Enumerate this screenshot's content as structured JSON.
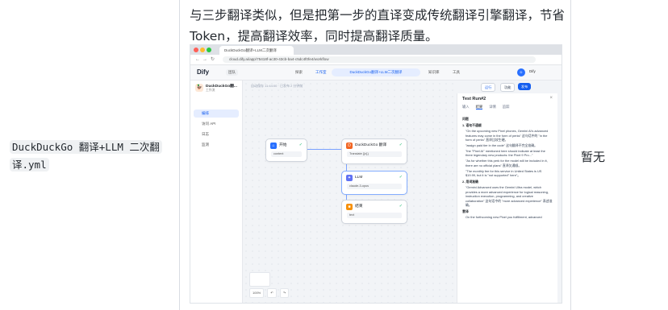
{
  "row": {
    "file_name": "DuckDuckGo 翻译+LLM 二次翻译.yml",
    "description": "与三步翻译类似，但是把第一步的直译变成传统翻译引擎翻译，节省 Token，提高翻译效率，同时提高翻译质量。",
    "status": "暂无"
  },
  "screenshot": {
    "browser_tab": "DuckDuckGo翻译+LLM二次翻译",
    "url": "cloud.dify.ai/app/75418f-ac30-43cb-ba4-c5dc4f0fe4/workflow",
    "logo": "Dify",
    "team": "团队",
    "nav": {
      "explore": "探索",
      "studio": "工作室",
      "app_pill": "DuckDuckGo翻译+LLM二次翻译",
      "knowledge": "知识库",
      "tools": "工具"
    },
    "user": "Dify",
    "app": {
      "name": "DuckDuckGo翻...",
      "type": "工作流"
    },
    "sidebar": [
      "编排",
      "访问 API",
      "日志",
      "监测"
    ],
    "breadcrumb": "自动保存 11:44:00 · 已发布 2 分钟前",
    "actions": {
      "run": "运行",
      "features": "功能",
      "publish": "发布"
    },
    "nodes": {
      "start": {
        "title": "开始",
        "sub": "content"
      },
      "duck": {
        "title": "DuckDuckGo 翻译",
        "sub": "Translate {{x}}"
      },
      "llm": {
        "title": "LLM",
        "sub": "claude-3-opus"
      },
      "end": {
        "title": "结束",
        "sub": "text"
      }
    },
    "zoom": {
      "level": "100%",
      "undo": "↶",
      "redo": "↷"
    },
    "run_panel": {
      "title": "Test Run#2",
      "tabs": [
        "输入",
        "结果",
        "详情",
        "追踪"
      ],
      "heading1": "问题",
      "item1": "1. 语句不通顺",
      "bullets1": [
        "\"On the upcoming new Pixel phones, Gemini AI's advanced features may come in the form of perks\" 这句话中的 \"in the form of perks\" 直译比较生硬。",
        "\"assign paid tier in the code\" 这句翻译不完全准确。",
        "\"the \"Pixel AI\" mentioned here should indicate at least the three legendary new products: the Pixel 9 Pro...\"",
        "\"As for whether this perk for the model will be included in it, there are no official plans\" 直译欠通顺。",
        "\"The monthly fee for this service in United States is US $19.99, but it is \"not supported\" here\"。"
      ],
      "item2": "2. 用词准确",
      "bullets2": [
        "\"Gemini Advanced uses the Gemini Ultra model, which provides a more advanced experience for logical reasoning, instruction execution, programming, and creative collaboration\" 这句话中的 \"more advanced experience\" 表述准确。"
      ],
      "heading2": "意译",
      "footer": "On the forthcoming new Pixel you fulfillment, advanced"
    }
  }
}
